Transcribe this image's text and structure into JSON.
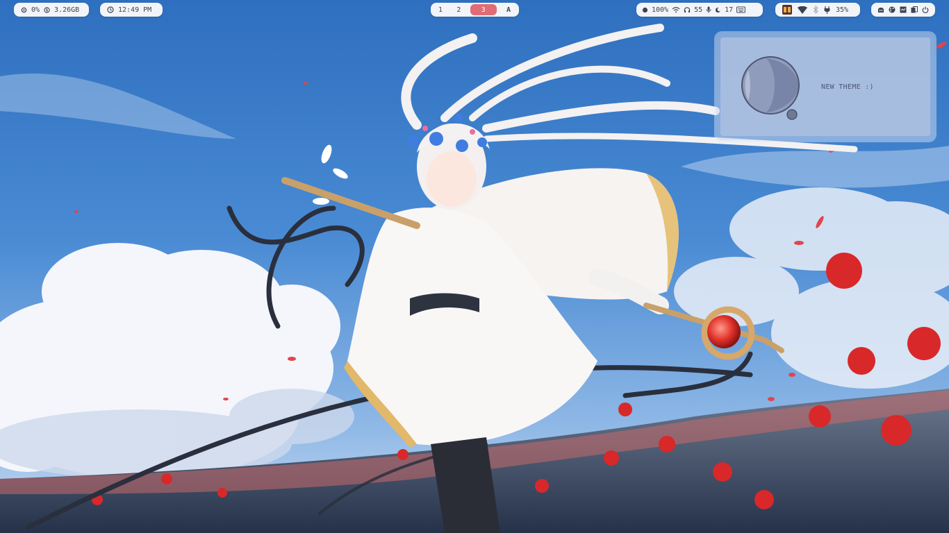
{
  "topbar": {
    "cpu_value": "0%",
    "mem_value": "3.26GB",
    "clock": "12:49 PM",
    "workspaces": [
      "1",
      "2",
      "3"
    ],
    "active_workspace": "3",
    "launcher_glyph": "A",
    "brightness": "100%",
    "headphone_volume": "55",
    "mic_volume": "17",
    "battery": "35%"
  },
  "widget": {
    "text": "NEW THEME :)"
  },
  "colors": {
    "bar_bg": "#f2f4f8",
    "accent": "#e06c75",
    "text": "#3b4252"
  },
  "icons": {
    "cpu": "cpu-icon",
    "memory": "memory-icon",
    "clock": "clock-icon",
    "brightness": "brightness-icon",
    "wifi": "wifi-icon",
    "headphones": "headphones-icon",
    "mic": "microphone-icon",
    "night": "night-mode-icon",
    "keyboard": "keyboard-icon",
    "tray_app": "tray-app-icon",
    "network": "network-icon",
    "bluetooth": "bluetooth-icon",
    "power_plug": "charging-icon",
    "lock": "lock-icon",
    "palette": "palette-icon",
    "screenshot": "screenshot-icon",
    "clipboard": "clipboard-icon",
    "power": "power-icon"
  }
}
